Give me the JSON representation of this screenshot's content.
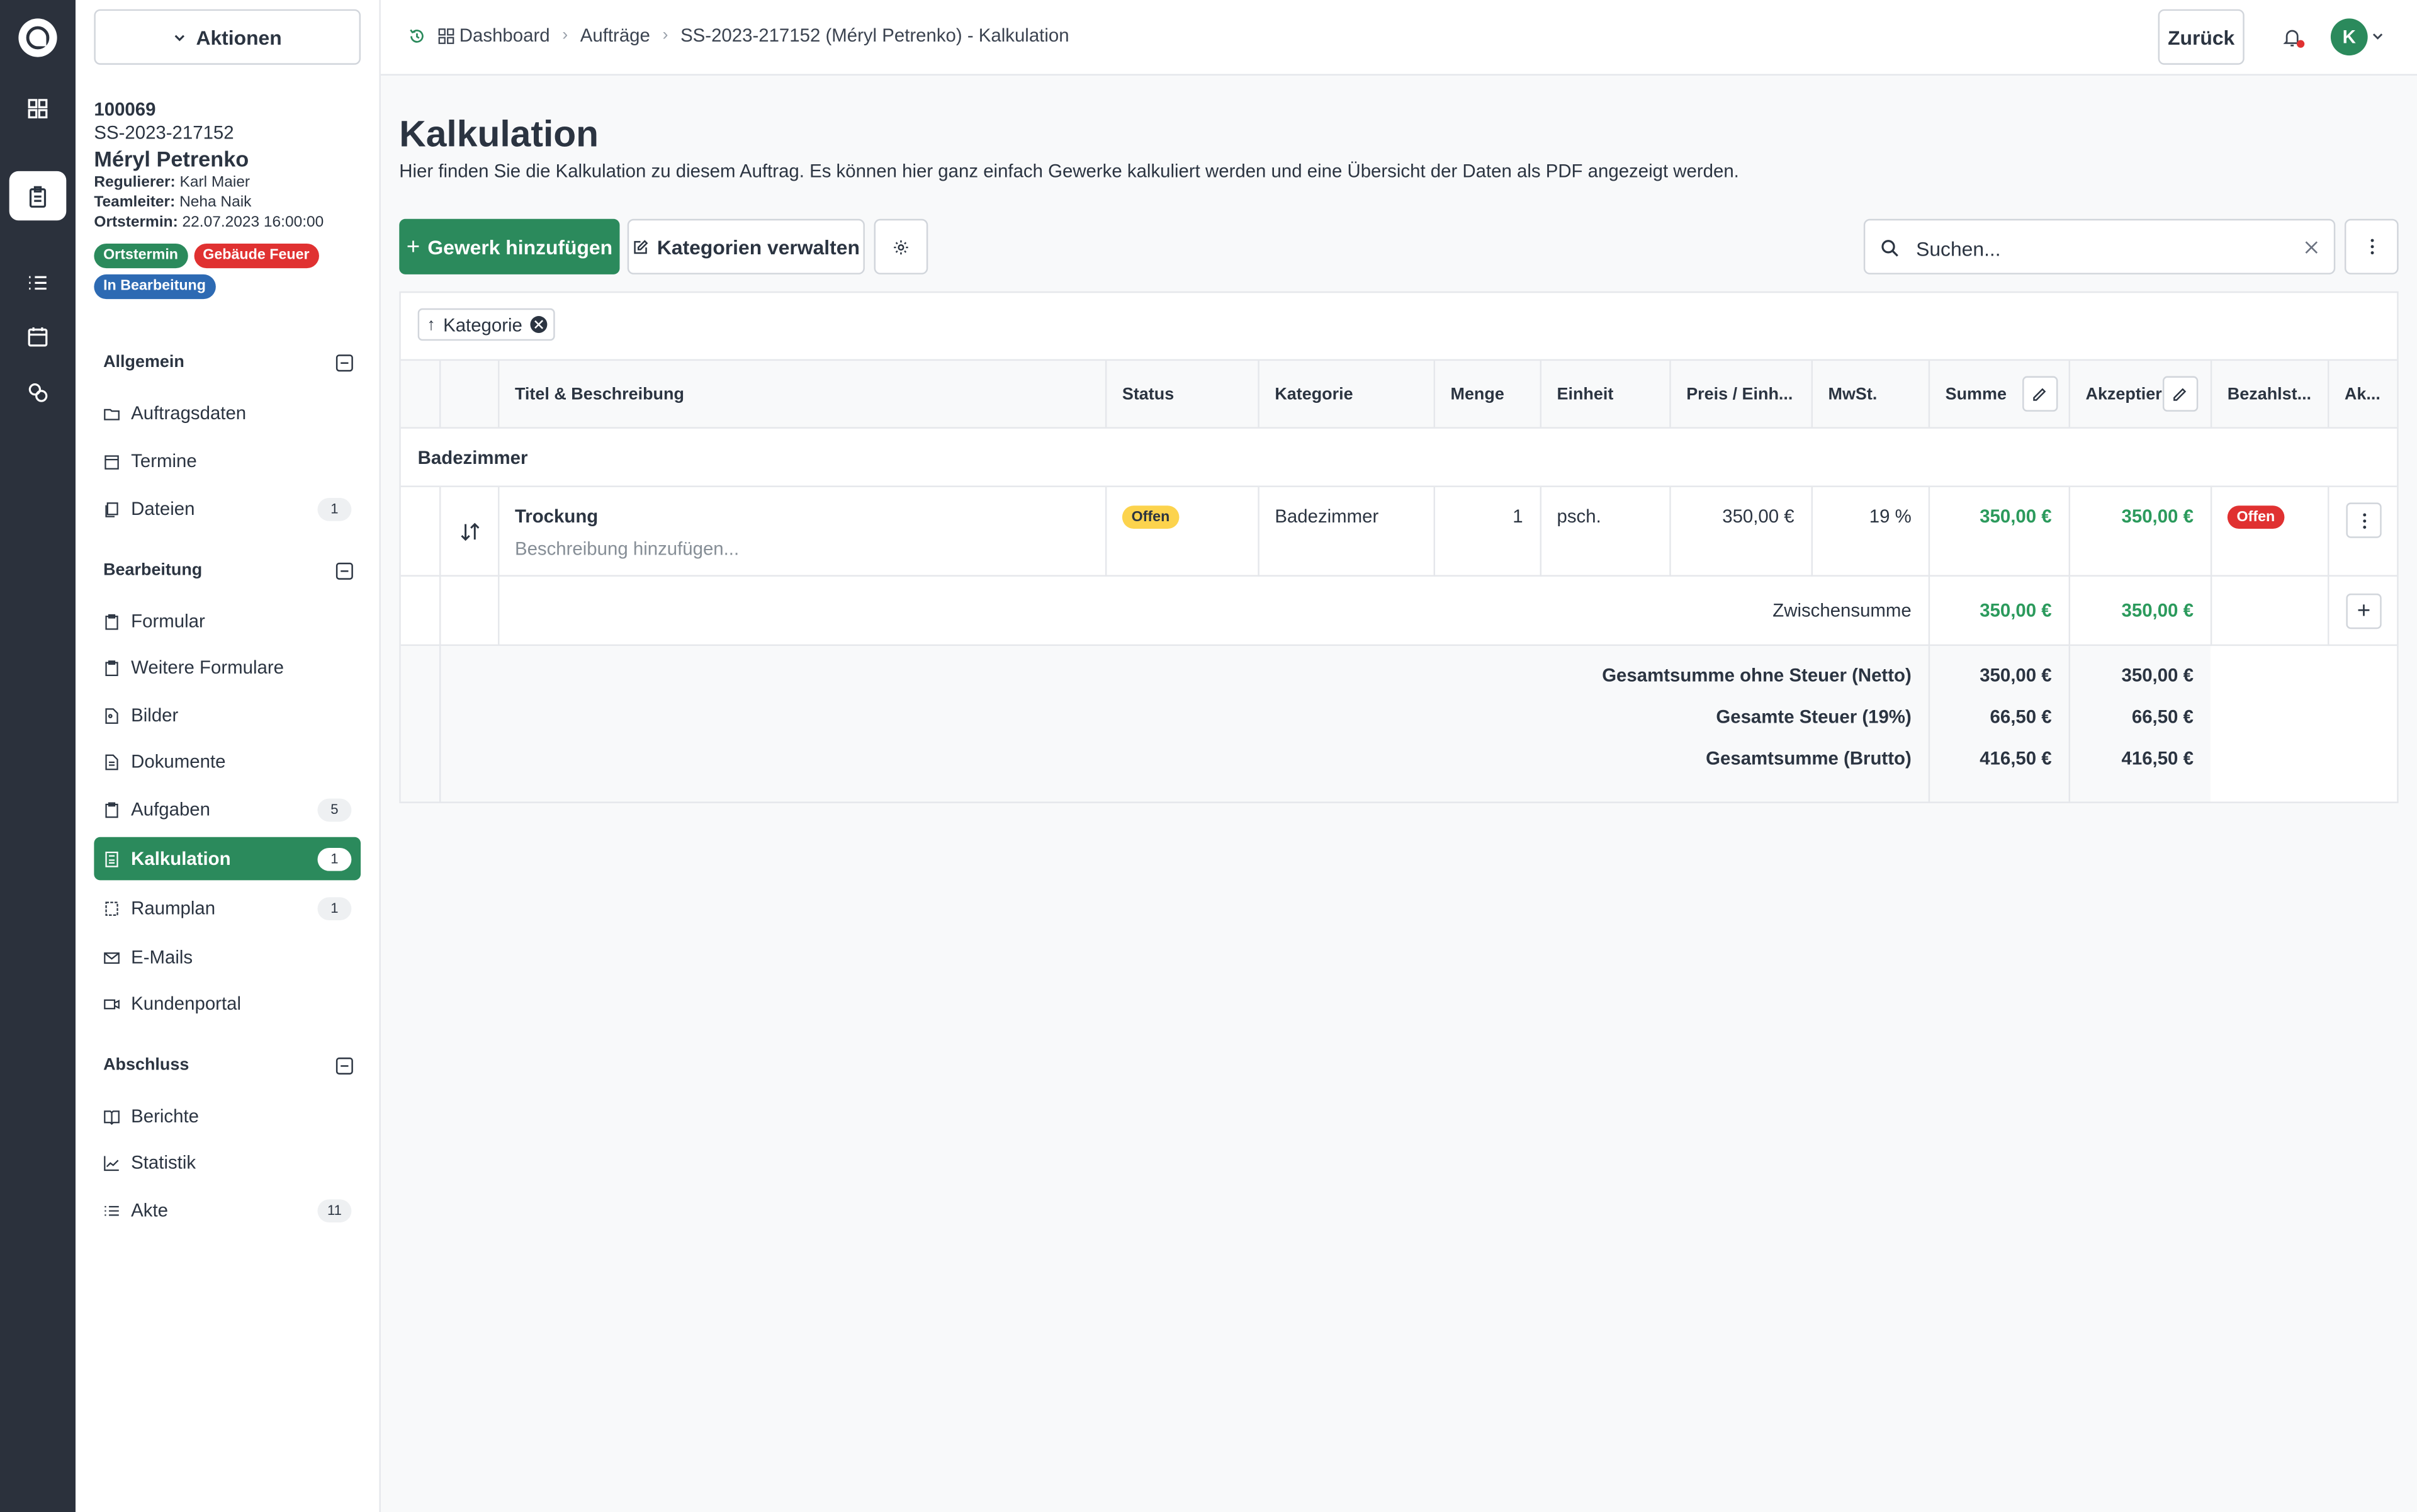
{
  "sidebar": {
    "actions_label": "Aktionen",
    "job": {
      "number": "100069",
      "ss": "SS-2023-217152",
      "name": "Méryl Petrenko",
      "regulierer_label": "Regulierer:",
      "regulierer": "Karl Maier",
      "teamleiter_label": "Teamleiter:",
      "teamleiter": "Neha Naik",
      "ortstermin_label": "Ortstermin:",
      "ortstermin": "22.07.2023 16:00:00",
      "badges": [
        "Ortstermin",
        "Gebäude Feuer",
        "In Bearbeitung"
      ]
    },
    "sections": [
      {
        "title": "Allgemein",
        "items": [
          {
            "label": "Auftragsdaten",
            "count": ""
          },
          {
            "label": "Termine",
            "count": ""
          },
          {
            "label": "Dateien",
            "count": "1"
          }
        ]
      },
      {
        "title": "Bearbeitung",
        "items": [
          {
            "label": "Formular",
            "count": ""
          },
          {
            "label": "Weitere Formulare",
            "count": ""
          },
          {
            "label": "Bilder",
            "count": ""
          },
          {
            "label": "Dokumente",
            "count": ""
          },
          {
            "label": "Aufgaben",
            "count": "5"
          },
          {
            "label": "Kalkulation",
            "count": "1"
          },
          {
            "label": "Raumplan",
            "count": "1"
          },
          {
            "label": "E-Mails",
            "count": ""
          },
          {
            "label": "Kundenportal",
            "count": ""
          }
        ]
      },
      {
        "title": "Abschluss",
        "items": [
          {
            "label": "Berichte",
            "count": ""
          },
          {
            "label": "Statistik",
            "count": ""
          },
          {
            "label": "Akte",
            "count": "11"
          }
        ]
      }
    ]
  },
  "topbar": {
    "breadcrumbs": [
      "Dashboard",
      "Aufträge",
      "SS-2023-217152 (Méryl Petrenko) - Kalkulation"
    ],
    "back_label": "Zurück",
    "avatar_initial": "K"
  },
  "main": {
    "title": "Kalkulation",
    "description": "Hier finden Sie die Kalkulation zu diesem Auftrag. Es können hier ganz einfach Gewerke kalkuliert werden und eine Übersicht der Daten als PDF angezeigt werden.",
    "add_button": "Gewerk hinzufügen",
    "categories_button": "Kategorien verwalten",
    "search_placeholder": "Suchen...",
    "sort_chip": "Kategorie",
    "columns": [
      "Titel & Beschreibung",
      "Status",
      "Kategorie",
      "Menge",
      "Einheit",
      "Preis / Einh...",
      "MwSt.",
      "Summe",
      "Akzeptier",
      "Bezahlst...",
      "Ak..."
    ],
    "group": "Badezimmer",
    "row": {
      "title": "Trockung",
      "description_placeholder": "Beschreibung hinzufügen...",
      "status": "Offen",
      "category": "Badezimmer",
      "quantity": "1",
      "unit": "psch.",
      "unit_price": "350,00 €",
      "vat": "19 %",
      "sum": "350,00 €",
      "accepted": "350,00 €",
      "paid_status": "Offen"
    },
    "subtotal": {
      "label": "Zwischensumme",
      "sum": "350,00 €",
      "accepted": "350,00 €"
    },
    "totals": [
      {
        "label": "Gesamtsumme ohne Steuer (Netto)",
        "sum": "350,00 €",
        "accepted": "350,00 €"
      },
      {
        "label": "Gesamte Steuer (19%)",
        "sum": "66,50 €",
        "accepted": "66,50 €"
      },
      {
        "label": "Gesamtsumme (Brutto)",
        "sum": "416,50 €",
        "accepted": "416,50 €"
      }
    ]
  },
  "colors": {
    "accent": "#2b8a5c",
    "rail": "#2b313c",
    "danger": "#e03131",
    "warning": "#fcd34d",
    "info": "#2d6ab3"
  }
}
